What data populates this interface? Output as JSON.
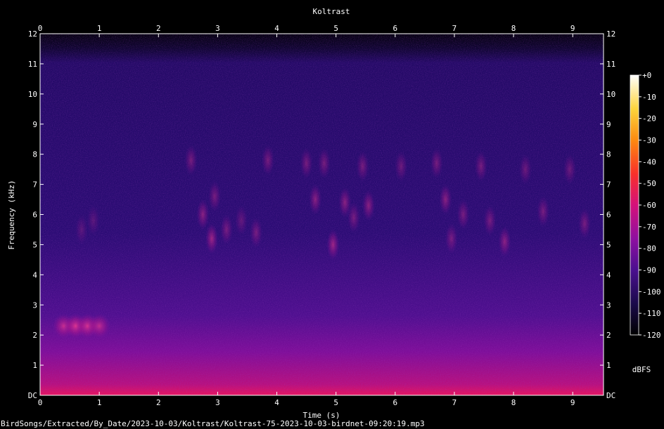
{
  "chart_data": {
    "type": "heatmap",
    "title": "Koltrast",
    "xlabel": "Time (s)",
    "ylabel": "Frequency (kHz)",
    "xlim": [
      0,
      9.52
    ],
    "ylim": [
      0,
      12
    ],
    "x_ticks": [
      0,
      1,
      2,
      3,
      4,
      5,
      6,
      7,
      8,
      9
    ],
    "y_ticks": [
      0,
      1,
      2,
      3,
      4,
      5,
      6,
      7,
      8,
      9,
      10,
      11,
      12
    ],
    "y_tick_labels": [
      "DC",
      "1",
      "2",
      "3",
      "4",
      "5",
      "6",
      "7",
      "8",
      "9",
      "10",
      "11",
      "12"
    ],
    "colorbar": {
      "label": "dBFS",
      "min": -120,
      "max": 0,
      "ticks": [
        "+0",
        "-10",
        "-20",
        "-30",
        "-40",
        "-50",
        "-60",
        "-70",
        "-80",
        "-90",
        "-100",
        "-110",
        "-120"
      ],
      "colors": [
        "#000000",
        "#1a0a4a",
        "#4a0f8f",
        "#8e0fa0",
        "#d4107a",
        "#f8302a",
        "#fd8a10",
        "#fdd43c",
        "#ffffff"
      ]
    },
    "series": [
      {
        "values": [
          [
            0.4,
            2.3,
            -65
          ],
          [
            0.6,
            2.3,
            -62
          ],
          [
            0.8,
            2.3,
            -63
          ],
          [
            1.0,
            2.3,
            -66
          ],
          [
            0.7,
            5.5,
            -75
          ],
          [
            0.9,
            5.8,
            -75
          ],
          [
            2.55,
            7.8,
            -72
          ],
          [
            2.75,
            6.0,
            -70
          ],
          [
            2.9,
            5.2,
            -68
          ],
          [
            2.95,
            6.6,
            -72
          ],
          [
            3.15,
            5.5,
            -72
          ],
          [
            3.4,
            5.8,
            -74
          ],
          [
            3.65,
            5.4,
            -72
          ],
          [
            3.85,
            7.8,
            -72
          ],
          [
            4.5,
            7.7,
            -72
          ],
          [
            4.65,
            6.5,
            -70
          ],
          [
            4.8,
            7.7,
            -72
          ],
          [
            4.95,
            5.0,
            -68
          ],
          [
            5.15,
            6.4,
            -70
          ],
          [
            5.3,
            5.9,
            -72
          ],
          [
            5.45,
            7.6,
            -72
          ],
          [
            5.55,
            6.3,
            -70
          ],
          [
            6.1,
            7.6,
            -73
          ],
          [
            6.7,
            7.7,
            -72
          ],
          [
            6.85,
            6.5,
            -70
          ],
          [
            6.95,
            5.2,
            -72
          ],
          [
            7.15,
            6.0,
            -72
          ],
          [
            7.45,
            7.6,
            -72
          ],
          [
            7.6,
            5.8,
            -72
          ],
          [
            7.85,
            5.1,
            -70
          ],
          [
            8.2,
            7.5,
            -73
          ],
          [
            8.5,
            6.1,
            -72
          ],
          [
            8.95,
            7.5,
            -73
          ],
          [
            9.2,
            5.7,
            -72
          ]
        ]
      }
    ]
  },
  "footer": {
    "file_path": "BirdSongs/Extracted/By_Date/2023-10-03/Koltrast/Koltrast-75-2023-10-03-birdnet-09:20:19.mp3"
  }
}
